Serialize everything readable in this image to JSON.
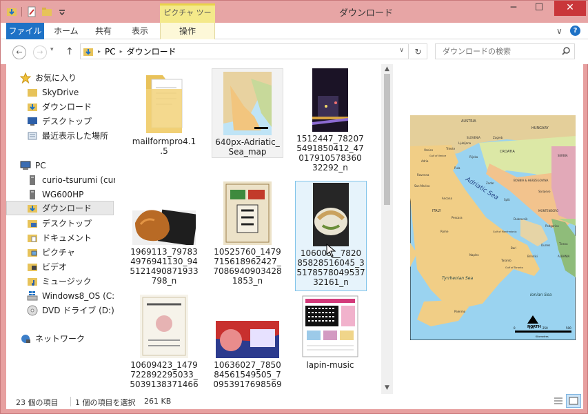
{
  "window": {
    "title": "ダウンロード",
    "context_tab_label": "ピクチャ ツール",
    "minimize": "─",
    "maximize": "☐",
    "close": "✕"
  },
  "ribbon": {
    "tabs": [
      "ファイル",
      "ホーム",
      "共有",
      "表示",
      "操作"
    ],
    "expand": "∨",
    "help": "?"
  },
  "address": {
    "back": "←",
    "forward": "→",
    "up": "↑",
    "path": [
      "PC",
      "ダウンロード"
    ],
    "separator": "▸",
    "dropdown": "∨",
    "refresh": "↻",
    "search_placeholder": "ダウンロードの検索"
  },
  "nav": {
    "favorites_label": "お気に入り",
    "favorites": [
      "SkyDrive",
      "ダウンロード",
      "デスクトップ",
      "最近表示した場所"
    ],
    "pc_label": "PC",
    "pc_items": [
      "curio-tsurumi (curi",
      "WG600HP",
      "ダウンロード",
      "デスクトップ",
      "ドキュメント",
      "ピクチャ",
      "ビデオ",
      "ミュージック",
      "Windows8_OS (C:",
      "DVD ドライブ (D:) Au"
    ],
    "network_label": "ネットワーク"
  },
  "files": [
    {
      "name": "mailformpro4.1.5",
      "lines": [
        "mailformpro4.1",
        ".5"
      ]
    },
    {
      "name": "640px-Adriatic_Sea_map",
      "lines": [
        "640px-Adriatic_",
        "Sea_map"
      ]
    },
    {
      "name": "1512447_782075491850412_470179105783603292_n",
      "lines": [
        "1512447_78207",
        "5491850412_47",
        "017910578360",
        "32292_n"
      ]
    },
    {
      "name": "1969113_797834976941130_945121490871933798_n",
      "lines": [
        "1969113_79783",
        "4976941130_94",
        "5121490871933",
        "798_n"
      ]
    },
    {
      "name": "10525760_1479715618962427_7086940903428185 3_n",
      "lines": [
        "10525760_1479",
        "715618962427_",
        "7086940903428",
        "1853_n"
      ]
    },
    {
      "name": "10600387_782085828516045_3517857804953732161_n",
      "lines": [
        "106003__7820",
        "85828516045_3",
        "5178578049537",
        "32161_n"
      ]
    },
    {
      "name": "10609423_1479722892295033_5039138371466",
      "lines": [
        "10609423_1479",
        "722892295033_",
        "5039138371466"
      ]
    },
    {
      "name": "10636027_785084561549505_70953917698569",
      "lines": [
        "10636027_7850",
        "84561549505_7",
        "0953917698569"
      ]
    },
    {
      "name": "lapin-music",
      "lines": [
        "lapin-music"
      ]
    }
  ],
  "preview_map": {
    "sea": "Adriatic Sea",
    "labels": [
      "AUSTRIA",
      "HUNGARY",
      "SLOVENIA",
      "Ljubljana",
      "Zagreb",
      "CROATIA",
      "Venice",
      "Trieste",
      "Gulf of Venice",
      "Rijeka",
      "Adria",
      "Pula",
      "Ravenna",
      "BOSNIA & HERZEGOVINA",
      "SERBIA",
      "Zadar",
      "Sarajevo",
      "San Marino",
      "Split",
      "Ancona",
      "ITALY",
      "MONTENEGRO",
      "Pescara",
      "Dubrovnik",
      "Podgorica",
      "Rome",
      "Gulf of Manfredonia",
      "Bari",
      "Durres",
      "Tirana",
      "Taranto",
      "Brindisi",
      "ALBANIA",
      "Naples",
      "Gulf of Taranto",
      "Tyrrhenian Sea",
      "Ionian Sea",
      "Palermo",
      "NORTH",
      "0",
      "125",
      "250",
      "500",
      "Kilometres"
    ]
  },
  "status": {
    "count": "23 個の項目",
    "selected": "1 個の項目を選択",
    "size": "261 KB"
  },
  "colors": {
    "titlebar": "#e7a5a5",
    "file_tab": "#1e72c6",
    "context": "#f4e98a",
    "close": "#c9363a",
    "selection": "#e6f3fb",
    "selection_border": "#82c4ea"
  }
}
